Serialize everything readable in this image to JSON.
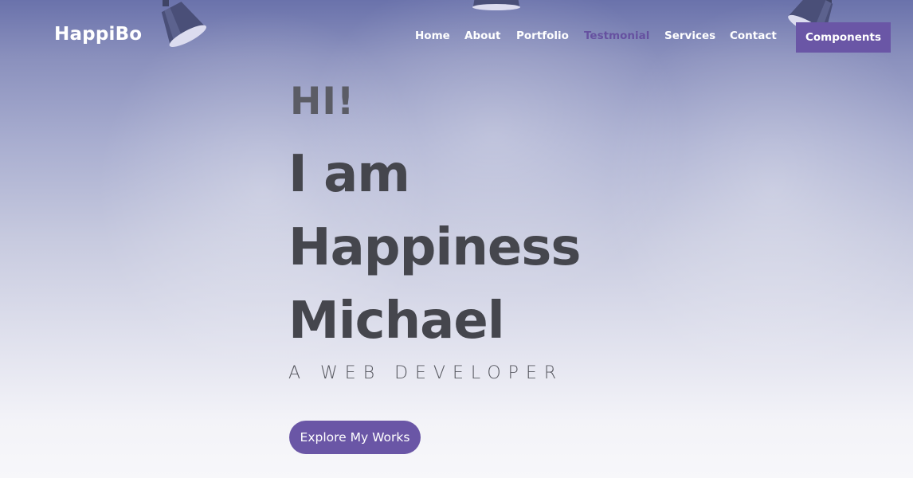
{
  "header": {
    "brand": "HappiBo",
    "nav": [
      {
        "label": "Home",
        "active": false
      },
      {
        "label": "About",
        "active": false
      },
      {
        "label": "Portfolio",
        "active": false
      },
      {
        "label": "Testmonial",
        "active": true
      },
      {
        "label": "Services",
        "active": false
      },
      {
        "label": "Contact",
        "active": false
      }
    ],
    "cta_label": "Components"
  },
  "hero": {
    "greeting": "HI!",
    "name_lines": [
      "I am",
      "Happiness",
      "Michael"
    ],
    "role": "A WEB DEVELOPER",
    "button_label": "Explore My Works"
  },
  "colors": {
    "accent": "#6a56a6",
    "active_nav": "#6651a0",
    "heading": "#45464d",
    "greeting": "#5b5c65",
    "nav_text": "#ffffff"
  },
  "icons": [
    "spotlight-lamp-icon"
  ]
}
